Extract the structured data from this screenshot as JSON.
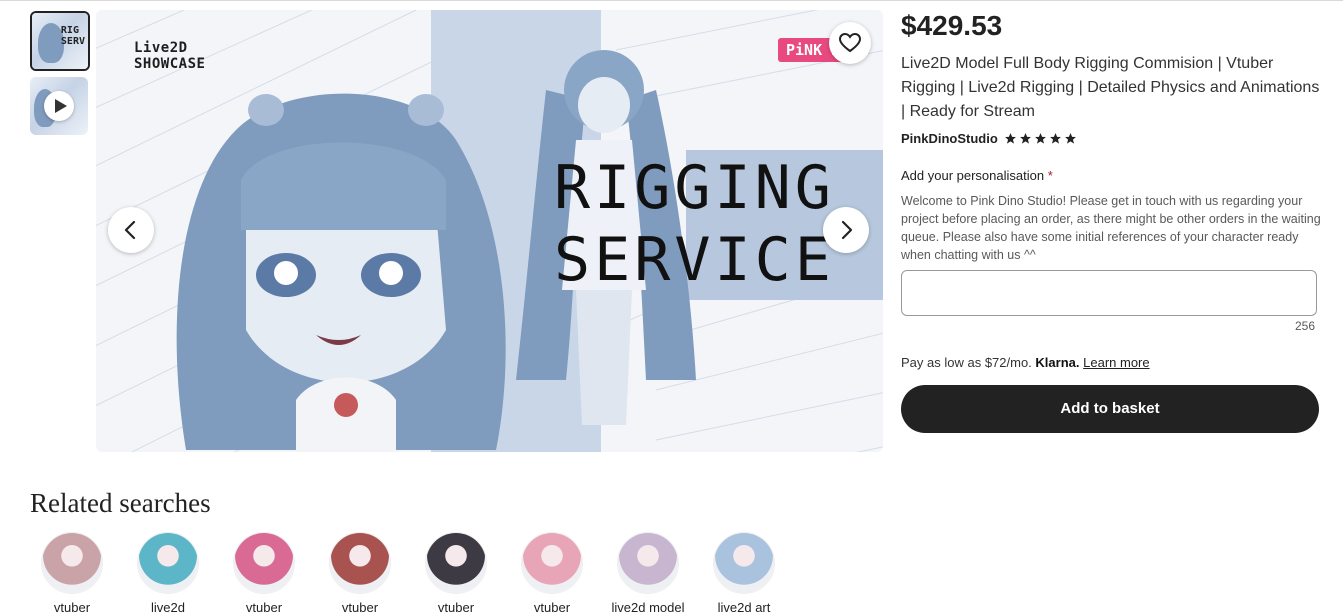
{
  "product": {
    "price": "$429.53",
    "title": "Live2D Model Full Body Rigging Commision | Vtuber Rigging | Live2d Rigging | Detailed Physics and Animations | Ready for Stream",
    "shop_name": "PinkDinoStudio",
    "rating_stars": 5
  },
  "hero": {
    "showcase_line1": "Live2D",
    "showcase_line2": "SHOWCASE",
    "headline_line1": "RIGGING",
    "headline_line2": "SERVICE",
    "badge": "PiNK DI",
    "thumb_text": "RIG\nSERV"
  },
  "personalisation": {
    "label": "Add your personalisation",
    "required_mark": "*",
    "help": "Welcome to Pink Dino Studio! Please get in touch with us regarding your project before placing an order, as there might be other orders in the waiting queue. Please also have some initial references of your character ready when chatting with us ^^",
    "value": "",
    "counter": "256"
  },
  "klarna": {
    "prefix": "Pay as low as $72/mo.",
    "brand": "Klarna.",
    "link": "Learn more"
  },
  "basket_label": "Add to basket",
  "related": {
    "title": "Related searches",
    "items": [
      {
        "label": "vtuber",
        "color": "#c9a3a8"
      },
      {
        "label": "live2d",
        "color": "#5cb6c8"
      },
      {
        "label": "vtuber",
        "color": "#d86a93"
      },
      {
        "label": "vtuber",
        "color": "#a8534f"
      },
      {
        "label": "vtuber",
        "color": "#3e3a44"
      },
      {
        "label": "vtuber",
        "color": "#e9a5b8"
      },
      {
        "label": "live2d model",
        "color": "#c8b5cf"
      },
      {
        "label": "live2d art",
        "color": "#a9c3df"
      }
    ]
  },
  "colors": {
    "accent_dark": "#222222",
    "badge": "#e84a7f",
    "hero_blue": "#7f9bbd",
    "required": "#a61a2e"
  },
  "icons": {
    "prev": "chevron-left-icon",
    "next": "chevron-right-icon",
    "favorite": "heart-icon",
    "play": "play-icon",
    "star": "star-icon"
  }
}
